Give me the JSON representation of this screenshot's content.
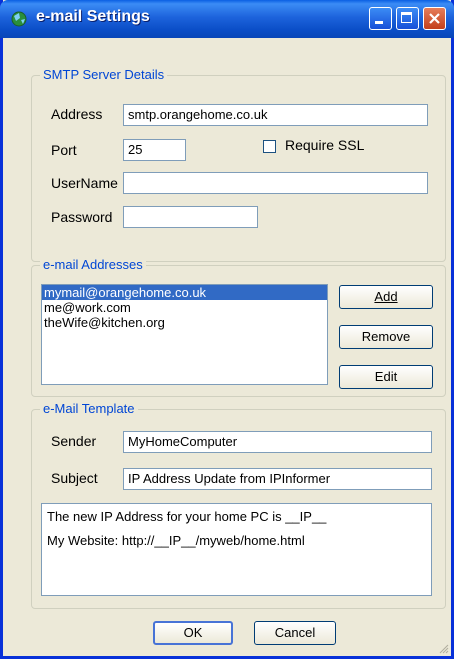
{
  "window": {
    "title": "e-mail Settings"
  },
  "smtp": {
    "legend": "SMTP Server Details",
    "address_label": "Address",
    "address_value": "smtp.orangehome.co.uk",
    "port_label": "Port",
    "port_value": "25",
    "ssl_label": "Require SSL",
    "ssl_checked": false,
    "username_label": "UserName",
    "username_value": "",
    "password_label": "Password",
    "password_value": ""
  },
  "addresses": {
    "legend": "e-mail Addresses",
    "items": [
      "mymail@orangehome.co.uk",
      "me@work.com",
      "theWife@kitchen.org"
    ],
    "selected_index": 0,
    "add_label": "Add",
    "remove_label": "Remove",
    "edit_label": "Edit"
  },
  "template": {
    "legend": "e-Mail Template",
    "sender_label": "Sender",
    "sender_value": "MyHomeComputer",
    "subject_label": "Subject",
    "subject_value": "IP Address Update from IPInformer",
    "body_lines": [
      "The new IP Address for your home PC is __IP__",
      "My Website: http://__IP__/myweb/home.html"
    ]
  },
  "footer": {
    "ok_label": "OK",
    "cancel_label": "Cancel"
  }
}
